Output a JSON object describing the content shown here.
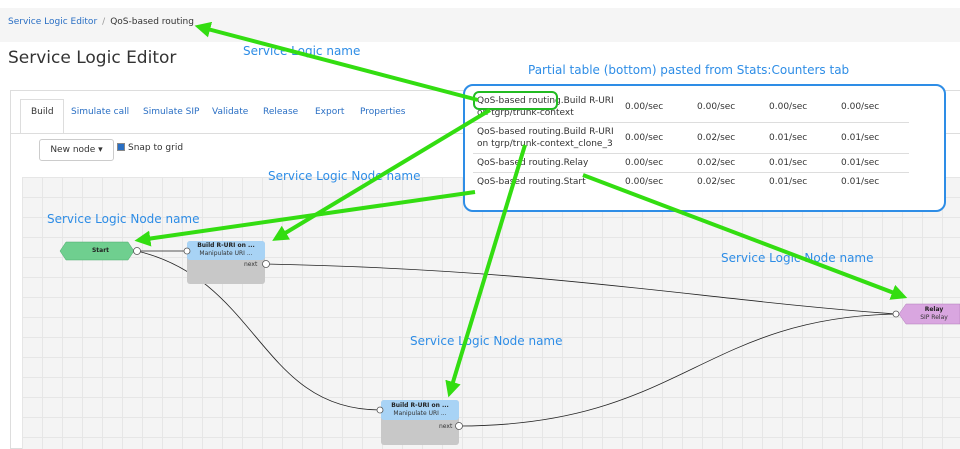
{
  "breadcrumb": {
    "root": "Service Logic Editor",
    "separator": "/",
    "current": "QoS-based routing"
  },
  "page_title": "Service Logic Editor",
  "tabs": [
    {
      "label": "Build",
      "active": true
    },
    {
      "label": "Simulate call",
      "active": false
    },
    {
      "label": "Simulate SIP",
      "active": false
    },
    {
      "label": "Validate",
      "active": false
    },
    {
      "label": "Release",
      "active": false
    },
    {
      "label": "Export",
      "active": false
    },
    {
      "label": "Properties",
      "active": false
    }
  ],
  "toolbar": {
    "new_node_label": "New node ▾",
    "snap_to_grid_label": "Snap to grid",
    "snap_to_grid_checked": true
  },
  "nodes": {
    "start": {
      "label": "Start",
      "color": "#6fcf8f"
    },
    "build_top": {
      "title": "Build R-URI on ...",
      "subtitle": "Manipulate URI ...",
      "port_label": "next",
      "color": "#a8d3f5"
    },
    "build_bottom": {
      "title": "Build R-URI on ...",
      "subtitle": "Manipulate URI ...",
      "port_label": "next",
      "color": "#a8d3f5"
    },
    "relay": {
      "title": "Relay",
      "subtitle": "SIP Relay",
      "color": "#d9a6e0"
    }
  },
  "stats_table": {
    "rows": [
      {
        "name_prefix": "QoS-based routing",
        "name_rest": ".Build R-URI on tgrp/trunk-context",
        "values": [
          "0.00/sec",
          "0.00/sec",
          "0.00/sec",
          "0.00/sec"
        ]
      },
      {
        "name_prefix": "QoS-based routing",
        "name_rest": ".Build R-URI on tgrp/trunk-context_clone_3",
        "values": [
          "0.00/sec",
          "0.02/sec",
          "0.01/sec",
          "0.01/sec"
        ]
      },
      {
        "name_prefix": "QoS-based routing",
        "name_rest": ".Relay",
        "values": [
          "0.00/sec",
          "0.02/sec",
          "0.01/sec",
          "0.01/sec"
        ]
      },
      {
        "name_prefix": "QoS-based routing",
        "name_rest": ".Start",
        "values": [
          "0.00/sec",
          "0.02/sec",
          "0.01/sec",
          "0.01/sec"
        ]
      }
    ]
  },
  "annotations": {
    "service_logic_name": "Service Logic name",
    "partial_table": "Partial table (bottom) pasted from Stats:Counters tab",
    "node_name_1": "Service Logic Node name",
    "node_name_2": "Service Logic Node name",
    "node_name_3": "Service Logic Node name",
    "node_name_4": "Service Logic Node name"
  },
  "colors": {
    "link": "#2a6fc4",
    "annotation_blue": "#2e8de6",
    "arrow_green": "#33dd11",
    "highlight_green": "#22bb22"
  }
}
